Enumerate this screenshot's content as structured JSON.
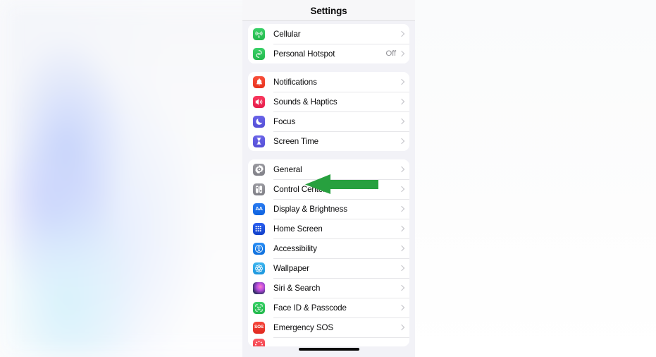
{
  "app": {
    "nav_title": "Settings",
    "home_indicator": true
  },
  "annotation": {
    "type": "arrow",
    "direction": "left",
    "color": "#27A03F",
    "points_at": "General"
  },
  "groups": [
    {
      "id": "connectivity",
      "rows": [
        {
          "label": "Cellular",
          "icon": "cellular-icon",
          "icon_class": "ic-cellular",
          "value": "",
          "chevron": true
        },
        {
          "label": "Personal Hotspot",
          "icon": "hotspot-icon",
          "icon_class": "ic-hotspot",
          "value": "Off",
          "chevron": true
        }
      ]
    },
    {
      "id": "alerts",
      "rows": [
        {
          "label": "Notifications",
          "icon": "bell-icon",
          "icon_class": "ic-notifications",
          "value": "",
          "chevron": true
        },
        {
          "label": "Sounds & Haptics",
          "icon": "speaker-icon",
          "icon_class": "ic-sounds",
          "value": "",
          "chevron": true
        },
        {
          "label": "Focus",
          "icon": "moon-icon",
          "icon_class": "ic-focus",
          "value": "",
          "chevron": true
        },
        {
          "label": "Screen Time",
          "icon": "hourglass-icon",
          "icon_class": "ic-screentime",
          "value": "",
          "chevron": true
        }
      ]
    },
    {
      "id": "system",
      "rows": [
        {
          "label": "General",
          "icon": "gear-icon",
          "icon_class": "ic-general",
          "value": "",
          "chevron": true
        },
        {
          "label": "Control Center",
          "icon": "control-center-icon",
          "icon_class": "ic-controlcenter",
          "value": "",
          "chevron": true
        },
        {
          "label": "Display & Brightness",
          "icon": "display-aa-icon",
          "icon_class": "ic-display",
          "value": "",
          "chevron": true
        },
        {
          "label": "Home Screen",
          "icon": "home-screen-grid-icon",
          "icon_class": "ic-homescreen",
          "value": "",
          "chevron": true
        },
        {
          "label": "Accessibility",
          "icon": "accessibility-icon",
          "icon_class": "ic-accessibility",
          "value": "",
          "chevron": true
        },
        {
          "label": "Wallpaper",
          "icon": "wallpaper-flower-icon",
          "icon_class": "ic-wallpaper",
          "value": "",
          "chevron": true
        },
        {
          "label": "Siri & Search",
          "icon": "siri-orb-icon",
          "icon_class": "ic-siri",
          "value": "",
          "chevron": true
        },
        {
          "label": "Face ID & Passcode",
          "icon": "face-id-icon",
          "icon_class": "ic-faceid",
          "value": "",
          "chevron": true
        },
        {
          "label": "Emergency SOS",
          "icon": "sos-icon",
          "icon_class": "ic-sos",
          "value": "",
          "chevron": true
        },
        {
          "label": "",
          "icon": "exposure-notifications-icon",
          "icon_class": "ic-exposure",
          "value": "",
          "chevron": false,
          "partial": true
        }
      ]
    }
  ]
}
